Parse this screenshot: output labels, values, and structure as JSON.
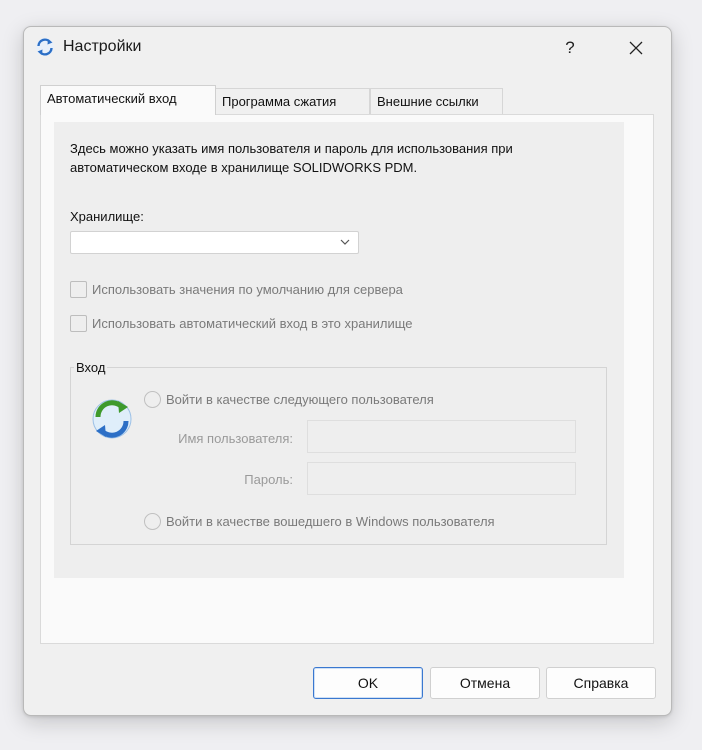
{
  "window": {
    "title": "Настройки",
    "help_label": "?"
  },
  "tabs": [
    {
      "label": "Автоматический вход",
      "active": true
    },
    {
      "label": "Программа сжатия",
      "active": false
    },
    {
      "label": "Внешние ссылки",
      "active": false
    }
  ],
  "autologin": {
    "description": "Здесь можно указать имя пользователя и пароль для использования при автоматическом входе в хранилище SOLIDWORKS PDM.",
    "storage_label": "Хранилище:",
    "storage_value": "",
    "use_server_defaults_label": "Использовать значения по умолчанию для сервера",
    "use_server_defaults_checked": false,
    "use_autologin_label": "Использовать автоматический вход в это хранилище",
    "use_autologin_checked": false,
    "login_group": {
      "title": "Вход",
      "login_as_user_label": "Войти в качестве следующего пользователя",
      "username_label": "Имя пользователя:",
      "username_value": "",
      "password_label": "Пароль:",
      "password_value": "",
      "login_as_windows_label": "Войти в качестве вошедшего в Windows пользователя"
    }
  },
  "buttons": {
    "ok": "OK",
    "cancel": "Отмена",
    "help": "Справка"
  },
  "colors": {
    "default_button_border": "#3a78d0",
    "icon_blue": "#2c6fc6",
    "icon_green": "#3e9a2c"
  }
}
